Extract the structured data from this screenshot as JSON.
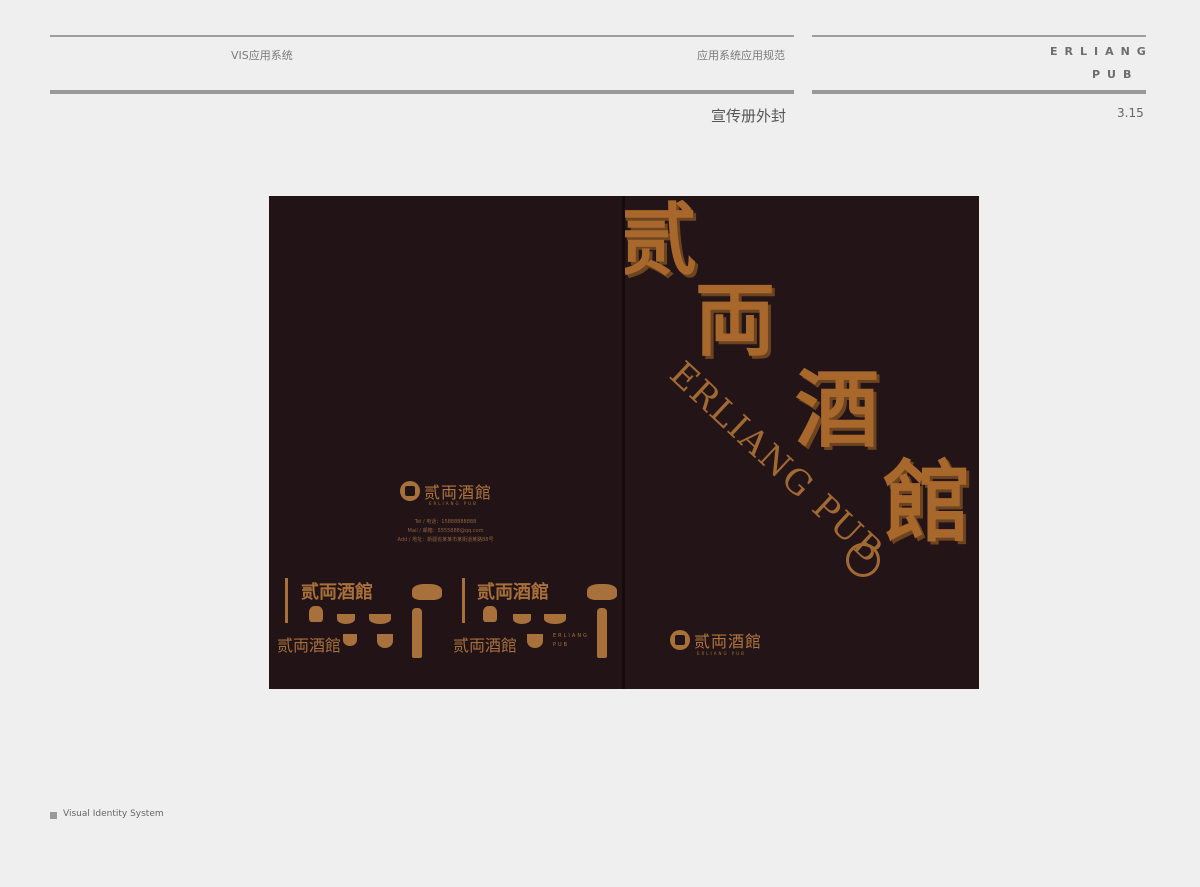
{
  "header": {
    "left_label": "VIS应用系统",
    "center_label": "应用系统应用规范",
    "brand_line1": "ERLIANG",
    "brand_line2": "PUB",
    "section_title": "宣传册外封",
    "page_number": "3.15"
  },
  "brochure": {
    "back": {
      "logo_cn": "贰両酒館",
      "logo_en": "ERLIANG PUB",
      "contact": [
        "Tel / 电话：15888888888",
        "Mail / 邮箱：5555888@qq.com",
        "Add / 地址：新疆省某某市某街道某路88号"
      ],
      "pattern_logo_cn": "贰両酒館",
      "pattern_vertical_en": "ERLIANG PUB"
    },
    "front": {
      "calligraphy": [
        "贰",
        "両",
        "酒",
        "館"
      ],
      "english_title": "ERLIANG PUB",
      "logo_cn": "贰両酒館",
      "logo_en": "ERLIANG PUB"
    }
  },
  "footer": {
    "label": "Visual Identity System"
  },
  "colors": {
    "background": "#efefef",
    "brochure_dark": "#221416",
    "gold": "#a8703a"
  }
}
